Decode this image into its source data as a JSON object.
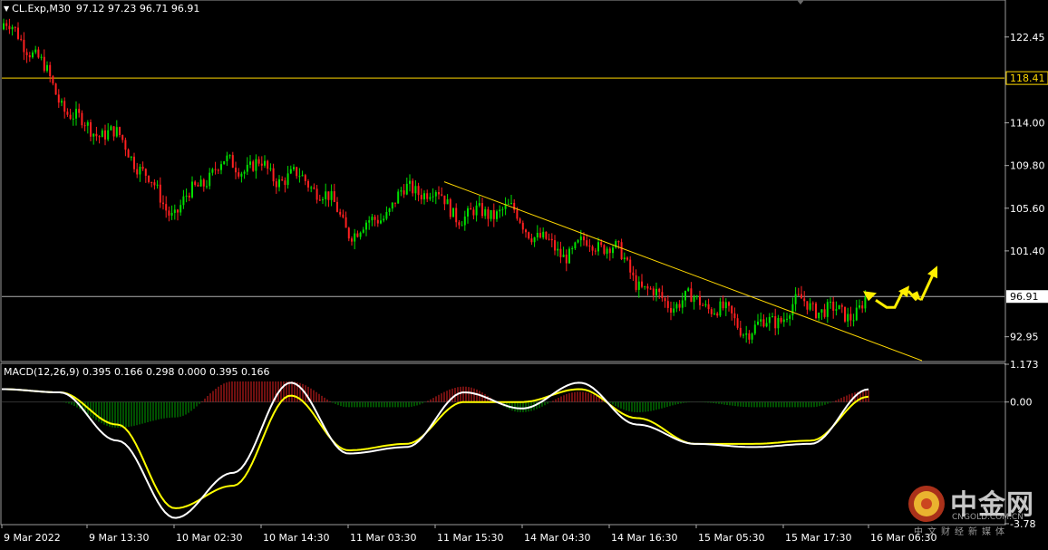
{
  "header": {
    "symbol": "CL.Exp,M30",
    "open": "97.12",
    "high": "97.23",
    "low": "96.71",
    "close": "96.91"
  },
  "macd_header": {
    "label": "MACD(12,26,9)",
    "values": "0.395 0.166 0.298 0.000 0.395 0.166"
  },
  "colors": {
    "background": "#000000",
    "bull_candle": "#00e000",
    "bear_candle": "#ff2020",
    "level_line": "#ffd800",
    "trendline": "#ffd800",
    "current_price_line": "#b0b0b0",
    "macd_line": "#ffffff",
    "signal_line": "#ffff00",
    "hist_positive": "#e02020",
    "hist_negative": "#00a000",
    "arrows": "#ffee00"
  },
  "watermark": {
    "brand_cn": "中金网",
    "site": "CNGOLD.COM.CN",
    "tagline": "中文财经新媒体",
    "logo_icon": "gold-coin-logo-icon"
  },
  "chart_data": [
    {
      "type": "candlestick",
      "title": "CL.Exp,M30",
      "ylim": [
        90.6,
        126.0
      ],
      "y_ticks": [
        "122.45",
        "114.00",
        "109.80",
        "105.60",
        "101.40",
        "92.95"
      ],
      "x_ticks": [
        "9 Mar 2022",
        "9 Mar 13:30",
        "10 Mar 02:30",
        "10 Mar 14:30",
        "11 Mar 03:30",
        "11 Mar 15:30",
        "14 Mar 04:30",
        "14 Mar 16:30",
        "15 Mar 05:30",
        "15 Mar 17:30",
        "16 Mar 06:30"
      ],
      "horizontal_levels": [
        {
          "value": 118.41,
          "label": "118.41",
          "style": "level"
        },
        {
          "value": 96.91,
          "label": "96.91",
          "style": "current-price"
        }
      ],
      "trendline": {
        "start_x_tick": "11 Mar 15:30",
        "start_value": 108.2,
        "end_x_tick": "16 Mar 06:30",
        "end_value": 90.6
      },
      "close_path": [
        {
          "x": "9 Mar 2022",
          "close": 123.4
        },
        {
          "x": "9 Mar 13:30",
          "close": 114.2
        },
        {
          "x": "10 Mar 02:30",
          "close": 106.2
        },
        {
          "x": "10 Mar 14:30",
          "close": 110.8
        },
        {
          "x": "11 Mar 03:30",
          "close": 104.2
        },
        {
          "x": "11 Mar 15:30",
          "close": 107.1
        },
        {
          "x": "14 Mar 04:30",
          "close": 103.6
        },
        {
          "x": "14 Mar 16:30",
          "close": 100.9
        },
        {
          "x": "15 Mar 05:30",
          "close": 95.3
        },
        {
          "x": "15 Mar 17:30",
          "close": 94.6
        },
        {
          "x": "16 Mar 06:30",
          "close": 96.9
        }
      ],
      "projection_arrows": 3
    },
    {
      "type": "macd",
      "title": "MACD(12,26,9)",
      "ylim": [
        -3.78,
        1.173
      ],
      "y_ticks": [
        "1.173",
        "0.00",
        "-3.78"
      ],
      "series": [
        {
          "name": "MACD",
          "values": [
            0.4,
            0.3,
            -1.2,
            -3.6,
            -2.2,
            0.6,
            -1.6,
            -1.4,
            0.3,
            -0.2,
            0.6,
            -0.7,
            -1.3,
            -1.4,
            -1.3,
            0.395
          ]
        },
        {
          "name": "Signal",
          "values": [
            0.4,
            0.3,
            -0.7,
            -3.3,
            -2.6,
            0.2,
            -1.5,
            -1.3,
            0.0,
            0.0,
            0.4,
            -0.5,
            -1.3,
            -1.3,
            -1.2,
            0.166
          ]
        }
      ]
    }
  ]
}
